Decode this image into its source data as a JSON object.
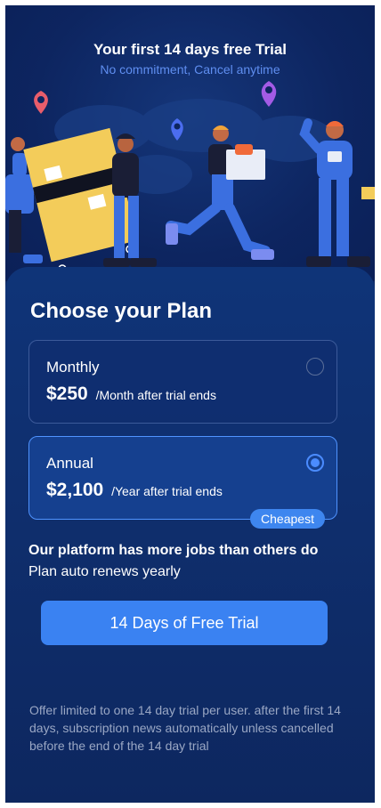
{
  "hero": {
    "title": "Your first 14 days free Trial",
    "subtitle": "No commitment, Cancel anytime"
  },
  "plans_section": {
    "title": "Choose your Plan",
    "plans": [
      {
        "name": "Monthly",
        "price": "$250",
        "suffix": "/Month after trial ends",
        "selected": false
      },
      {
        "name": "Annual",
        "price": "$2,100",
        "suffix": "/Year after trial ends",
        "selected": true,
        "badge": "Cheapest"
      }
    ]
  },
  "info": {
    "headline": "Our platform has more jobs than others do",
    "renewal": "Plan auto renews yearly"
  },
  "cta": {
    "label": "14 Days of Free Trial"
  },
  "disclaimer": "Offer limited to one 14 day trial per user. after the first 14 days, subscription news automatically unless cancelled before the end of the 14 day trial",
  "colors": {
    "background": "#0f2b66",
    "accent": "#3a82f2",
    "subtitle": "#5f8ef0",
    "badge": "#3e86ef"
  }
}
